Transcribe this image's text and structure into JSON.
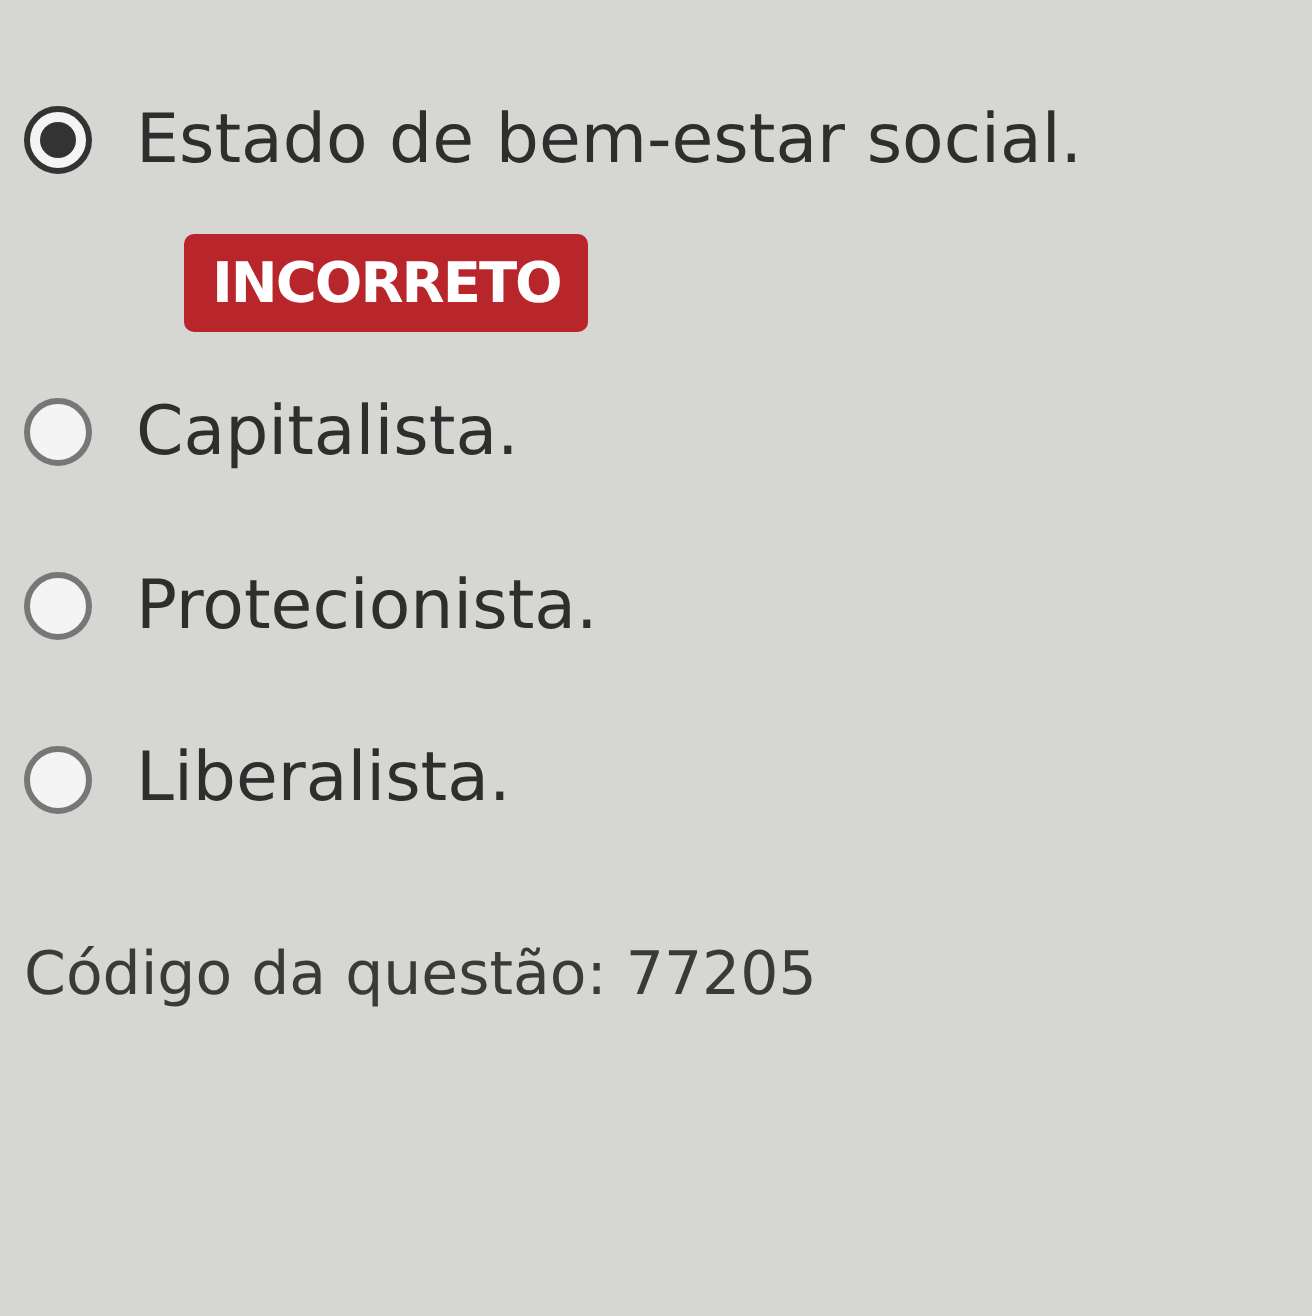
{
  "options": [
    {
      "label": "Estado de bem-estar social.",
      "selected": true,
      "badge": "INCORRETO"
    },
    {
      "label": "Capitalista.",
      "selected": false
    },
    {
      "label": "Protecionista.",
      "selected": false
    },
    {
      "label": "Liberalista.",
      "selected": false
    }
  ],
  "question_code": "Código da questão: 77205"
}
